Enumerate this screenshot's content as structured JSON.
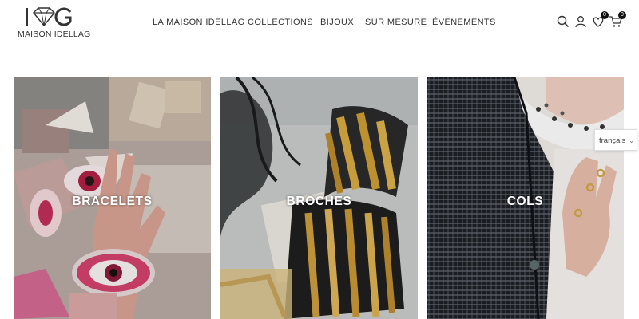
{
  "brand": {
    "name": "MAISON IDELLAG"
  },
  "nav": {
    "items": [
      {
        "label": "LA MAISON IDELLAG"
      },
      {
        "label": "COLLECTIONS"
      },
      {
        "label": "BIJOUX"
      },
      {
        "label": "SUR MESURE"
      },
      {
        "label": "ÉVENEMENTS"
      }
    ]
  },
  "header_icons": {
    "search": "search-icon",
    "account": "user-icon",
    "wishlist": "heart-icon",
    "wishlist_count": "0",
    "cart": "cart-icon",
    "cart_count": "0"
  },
  "categories": [
    {
      "title": "BRACELETS"
    },
    {
      "title": "BROCHES"
    },
    {
      "title": "COLS"
    }
  ],
  "language": {
    "selected": "français"
  },
  "colors": {
    "text": "#222222",
    "badge": "#111111",
    "card_title": "#ffffff"
  }
}
